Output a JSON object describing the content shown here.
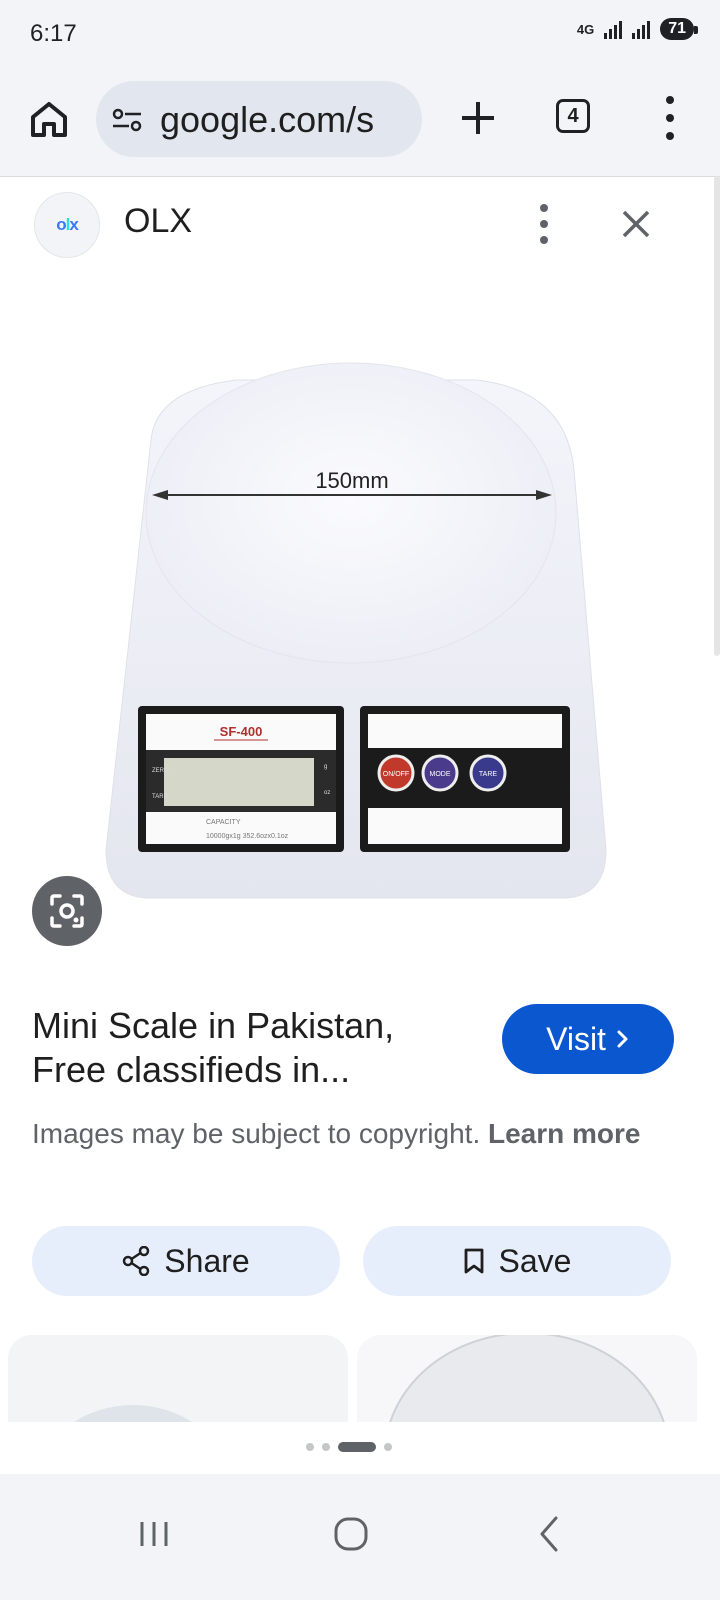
{
  "status_bar": {
    "time": "6:17",
    "network": "4G",
    "battery": "71"
  },
  "browser": {
    "url": "google.com/s",
    "tab_count": "4",
    "icons": [
      "home-icon",
      "site-settings-icon",
      "plus-icon",
      "tabs-icon",
      "more-vert-icon"
    ]
  },
  "source": {
    "name": "OLX",
    "logo_text": "olx",
    "icons": [
      "more-vert-icon",
      "close-icon"
    ]
  },
  "product_image": {
    "dimension_label": "150mm",
    "model_label": "SF-400",
    "capacity_label": "CAPACITY",
    "capacity_value": "10000gx1g 352.6ozx0.1oz",
    "button_labels": [
      "ON/OFF",
      "MODE",
      "TARE"
    ],
    "side_labels": [
      "ZERO",
      "TARE",
      "g",
      "oz"
    ]
  },
  "result": {
    "title": "Mini Scale in Pakistan, Free classifieds in...",
    "visit_label": "Visit",
    "copyright_text": "Images may be subject to copyright.",
    "learn_more_label": "Learn more"
  },
  "actions": {
    "share_label": "Share",
    "save_label": "Save"
  },
  "pager": {
    "count": 4,
    "active_index": 2
  },
  "colors": {
    "accent": "#0b57d0",
    "pill_bg": "#e7eefb",
    "status_bg": "#f2f4f8"
  }
}
